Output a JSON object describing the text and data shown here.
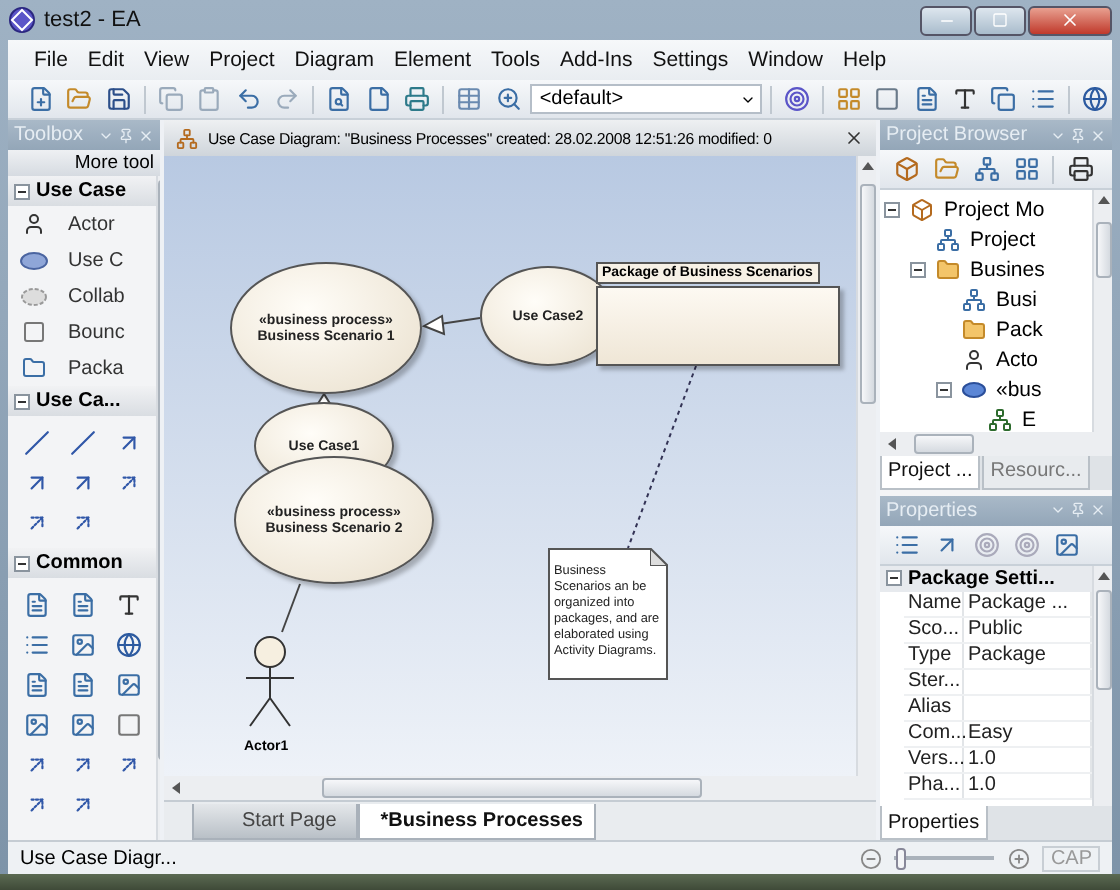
{
  "window": {
    "title": "test2 - EA"
  },
  "menu": [
    "File",
    "Edit",
    "View",
    "Project",
    "Diagram",
    "Element",
    "Tools",
    "Add-Ins",
    "Settings",
    "Window",
    "Help"
  ],
  "toolbar": {
    "style_dropdown": "<default>"
  },
  "toolbox": {
    "title": "Toolbox",
    "more": "More tool",
    "sections": [
      {
        "title": "Use Case",
        "expanded": true,
        "items": [
          {
            "label": "Actor",
            "kind": "actor"
          },
          {
            "label": "Use C",
            "kind": "usecase"
          },
          {
            "label": "Collab",
            "kind": "collaboration"
          },
          {
            "label": "Bounc",
            "kind": "boundary"
          },
          {
            "label": "Packa",
            "kind": "package"
          }
        ]
      },
      {
        "title": "Use Ca...",
        "expanded": true,
        "tools": [
          {
            "kind": "slash"
          },
          {
            "kind": "slash"
          },
          {
            "kind": "arrow"
          },
          {
            "kind": "arrow"
          },
          {
            "kind": "arrow"
          },
          {
            "kind": "dashed"
          },
          {
            "kind": "dashed"
          },
          {
            "kind": "dashed"
          }
        ]
      },
      {
        "title": "Common",
        "expanded": true,
        "tools": [
          {
            "kind": "doc"
          },
          {
            "kind": "doc"
          },
          {
            "kind": "text"
          },
          {
            "kind": "list"
          },
          {
            "kind": "image"
          },
          {
            "kind": "globe"
          },
          {
            "kind": "doc"
          },
          {
            "kind": "doc"
          },
          {
            "kind": "image"
          },
          {
            "kind": "image"
          },
          {
            "kind": "image"
          },
          {
            "kind": "boundary"
          },
          {
            "kind": "dashed"
          },
          {
            "kind": "dashed"
          },
          {
            "kind": "dashed"
          },
          {
            "kind": "dashed"
          },
          {
            "kind": "dashed"
          }
        ]
      }
    ]
  },
  "diagram": {
    "header": "Use Case Diagram: \"Business Processes\"  created: 28.02.2008 12:51:26  modified: 0",
    "elements": [
      {
        "kind": "usecase",
        "stereotype": "«business process»",
        "name": "Business Scenario 1"
      },
      {
        "kind": "usecase",
        "name": "Use Case2"
      },
      {
        "kind": "package",
        "name": "Package of Business Scenarios"
      },
      {
        "kind": "usecase",
        "name": "Use Case1"
      },
      {
        "kind": "usecase",
        "stereotype": "«business process»",
        "name": "Business Scenario 2"
      },
      {
        "kind": "note",
        "text": "Business Scenarios an be organized into packages, and are elaborated using Activity Diagrams."
      },
      {
        "kind": "actor",
        "name": "Actor1"
      }
    ],
    "tabs": [
      {
        "label": "Start Page",
        "selected": false
      },
      {
        "label": "*Business Processes",
        "selected": true
      }
    ]
  },
  "project_browser": {
    "title": "Project Browser",
    "tree": [
      {
        "label": "Project Mo",
        "kind": "model",
        "expanded": true,
        "children": [
          {
            "label": "Project",
            "kind": "diagram"
          },
          {
            "label": "Busines",
            "kind": "folder",
            "expanded": true,
            "children": [
              {
                "label": "Busi",
                "kind": "diagram"
              },
              {
                "label": "Pack",
                "kind": "folder"
              },
              {
                "label": "Acto",
                "kind": "actor"
              },
              {
                "label": "«bus",
                "kind": "usecase",
                "expanded": true,
                "children": [
                  {
                    "label": "E",
                    "kind": "activity"
                  }
                ]
              }
            ]
          }
        ]
      }
    ],
    "tabs": [
      {
        "label": "Project ...",
        "selected": true
      },
      {
        "label": "Resourc...",
        "selected": false
      }
    ]
  },
  "properties": {
    "title": "Properties",
    "section": "Package Setti...",
    "rows": [
      {
        "name": "Name",
        "value": "Package ..."
      },
      {
        "name": "Sco...",
        "value": "Public"
      },
      {
        "name": "Type",
        "value": "Package"
      },
      {
        "name": "Ster..."
      },
      {
        "name": "Alias"
      },
      {
        "name": "Com...",
        "value": "Easy"
      },
      {
        "name": "Vers...",
        "value": "1.0"
      },
      {
        "name": "Pha...",
        "value": "1.0"
      }
    ],
    "tabs": [
      {
        "label": "Properties",
        "selected": true
      }
    ]
  },
  "status_bar": {
    "text": "Use Case Diagr...",
    "zoom": {
      "level": 0.05
    },
    "indicator": "CAP"
  }
}
